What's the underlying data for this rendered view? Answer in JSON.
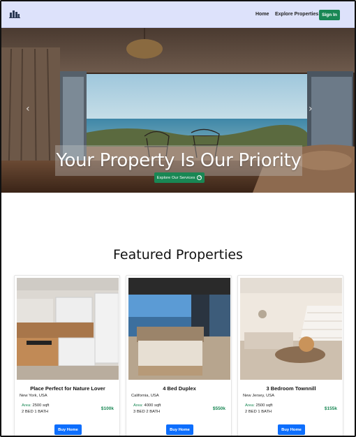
{
  "nav": {
    "logo_icon": "building-icon",
    "home": "Home",
    "explore": "Explore Properties",
    "signin": "Sign In"
  },
  "hero": {
    "title": "Your Property Is Our Priority",
    "button": "Explore Our Services",
    "button_icon": "circle-arrow-right-icon",
    "prev_icon": "chevron-left-icon",
    "next_icon": "chevron-right-icon"
  },
  "featured": {
    "heading": "Featured Properties",
    "area_label": "Area:",
    "buy_label": "Buy Home",
    "cards": [
      {
        "title": "Place Perfect for Nature Lover",
        "location": "New York, USA",
        "area": "2500 sqft",
        "beds": "2 BED 1 BATH",
        "price": "$100k"
      },
      {
        "title": "4 Bed Duplex",
        "location": "California, USA",
        "area": "4000 sqft",
        "beds": "3 BED 2 BATH",
        "price": "$550k"
      },
      {
        "title": "3 Bedroom Townnill",
        "location": "New Jersey, USA",
        "area": "2500 sqft",
        "beds": "2 BED 1 BATH",
        "price": "$155k"
      }
    ]
  },
  "colors": {
    "nav_bg": "#dde2fb",
    "accent_green": "#198754",
    "buy_blue": "#0d6efd"
  }
}
